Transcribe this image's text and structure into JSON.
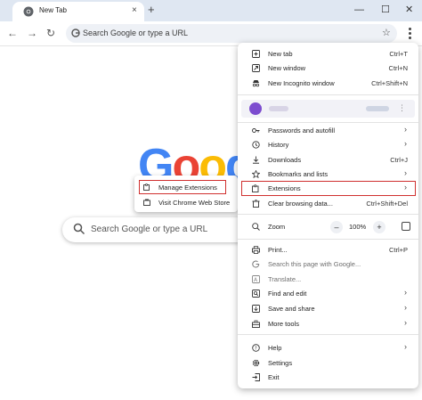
{
  "browser": {
    "tab_title": "New Tab",
    "tab_close": "×",
    "new_tab_symbol": "+",
    "minimize_symbol": "—",
    "maximize_symbol": "☐",
    "close_symbol": "✕",
    "back_symbol": "←",
    "forward_symbol": "→",
    "reload_symbol": "↻",
    "omnibox_placeholder": "Search Google or type a URL",
    "bookmark_symbol": "☆"
  },
  "page": {
    "logo_letters": [
      "G",
      "o",
      "o",
      "g"
    ],
    "logo_colors": [
      "#4285f4",
      "#ea4335",
      "#fbbc05",
      "#4285f4"
    ],
    "search_placeholder": "Search Google or type a URL"
  },
  "extensions_submenu": {
    "items": [
      {
        "label": "Manage Extensions",
        "icon": "puzzle-icon"
      },
      {
        "label": "Visit Chrome Web Store",
        "icon": "web-store-icon"
      }
    ],
    "highlight_color": "#d0302f"
  },
  "menu": {
    "new_tab": {
      "label": "New tab",
      "shortcut": "Ctrl+T"
    },
    "new_window": {
      "label": "New window",
      "shortcut": "Ctrl+N"
    },
    "new_incognito": {
      "label": "New Incognito window",
      "shortcut": "Ctrl+Shift+N"
    },
    "passwords": {
      "label": "Passwords and autofill",
      "arrow": "›"
    },
    "history": {
      "label": "History",
      "arrow": "›"
    },
    "downloads": {
      "label": "Downloads",
      "shortcut": "Ctrl+J"
    },
    "bookmarks": {
      "label": "Bookmarks and lists",
      "arrow": "›"
    },
    "extensions": {
      "label": "Extensions",
      "arrow": "›"
    },
    "clear_data": {
      "label": "Clear browsing data...",
      "shortcut": "Ctrl+Shift+Del"
    },
    "zoom": {
      "label": "Zoom",
      "minus": "–",
      "value": "100%",
      "plus": "+"
    },
    "print": {
      "label": "Print...",
      "shortcut": "Ctrl+P"
    },
    "search_page": {
      "label": "Search this page with Google..."
    },
    "translate": {
      "label": "Translate..."
    },
    "find_edit": {
      "label": "Find and edit",
      "arrow": "›"
    },
    "save_share": {
      "label": "Save and share",
      "arrow": "›"
    },
    "more_tools": {
      "label": "More tools",
      "arrow": "›"
    },
    "help": {
      "label": "Help",
      "arrow": "›"
    },
    "settings": {
      "label": "Settings"
    },
    "exit": {
      "label": "Exit"
    },
    "profile_kebab": "⋮"
  }
}
